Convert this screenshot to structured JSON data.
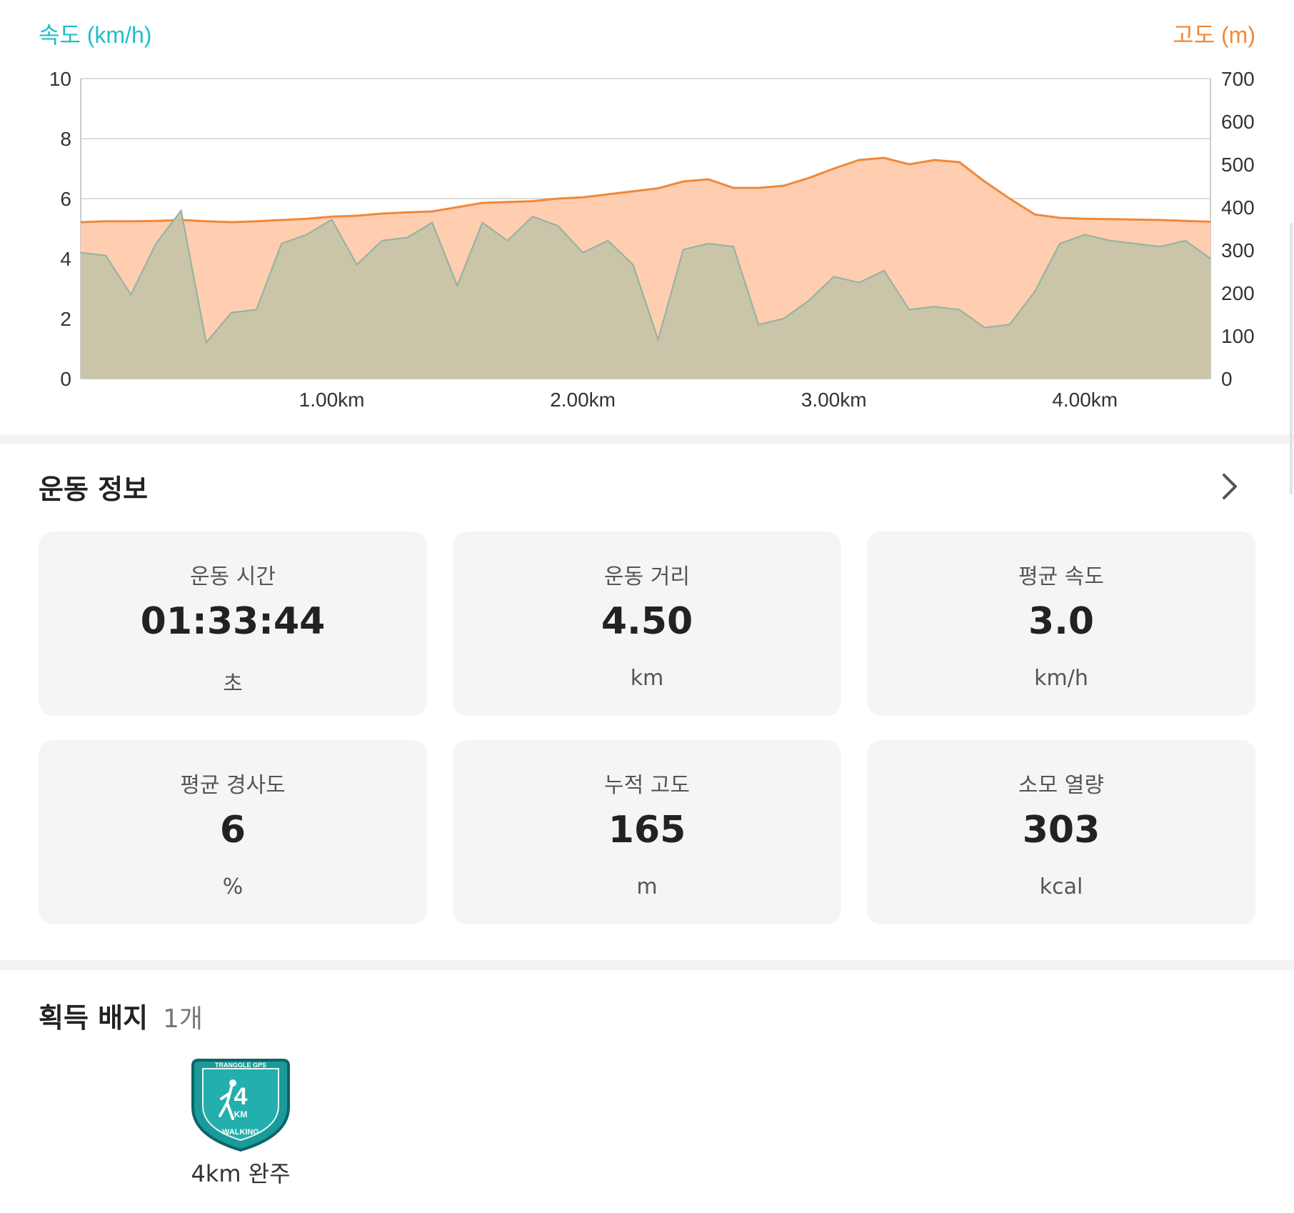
{
  "chart_data": {
    "type": "area",
    "x": [
      0,
      0.1,
      0.2,
      0.3,
      0.4,
      0.5,
      0.6,
      0.7,
      0.8,
      0.9,
      1.0,
      1.1,
      1.2,
      1.3,
      1.4,
      1.5,
      1.6,
      1.7,
      1.8,
      1.9,
      2.0,
      2.1,
      2.2,
      2.3,
      2.4,
      2.5,
      2.6,
      2.7,
      2.8,
      2.9,
      3.0,
      3.1,
      3.2,
      3.3,
      3.4,
      3.5,
      3.6,
      3.7,
      3.8,
      3.9,
      4.0,
      4.1,
      4.2,
      4.3,
      4.4,
      4.5
    ],
    "xlabel": "",
    "x_ticks": [
      "1.00km",
      "2.00km",
      "3.00km",
      "4.00km"
    ],
    "x_tick_values": [
      1,
      2,
      3,
      4
    ],
    "xlim": [
      0,
      4.5
    ],
    "series": [
      {
        "name": "속도 (km/h)",
        "axis": "left",
        "color": "#1fbfc8",
        "values": [
          4.2,
          4.1,
          2.8,
          4.5,
          5.6,
          1.2,
          2.2,
          2.3,
          4.5,
          4.8,
          5.3,
          3.8,
          4.6,
          4.7,
          5.2,
          3.1,
          5.2,
          4.6,
          5.4,
          5.1,
          4.2,
          4.6,
          3.8,
          1.3,
          4.3,
          4.5,
          4.4,
          1.8,
          2.0,
          2.6,
          3.4,
          3.2,
          3.6,
          2.3,
          2.4,
          2.3,
          1.7,
          1.8,
          2.9,
          4.5,
          4.8,
          4.6,
          4.5,
          4.4,
          4.6,
          4.0
        ]
      },
      {
        "name": "고도 (m)",
        "axis": "right",
        "color": "#f0883a",
        "values": [
          365,
          367,
          367,
          368,
          370,
          367,
          365,
          367,
          370,
          373,
          378,
          380,
          385,
          388,
          390,
          400,
          410,
          412,
          414,
          420,
          423,
          430,
          437,
          444,
          460,
          465,
          445,
          445,
          450,
          468,
          490,
          510,
          515,
          500,
          510,
          505,
          460,
          420,
          383,
          375,
          373,
          372,
          371,
          370,
          368,
          366
        ]
      }
    ],
    "ylim": [
      0,
      10
    ],
    "y_ticks": [
      0,
      2,
      4,
      6,
      8,
      10
    ],
    "y2lim": [
      0,
      700
    ],
    "y2_ticks": [
      0,
      100,
      200,
      300,
      400,
      500,
      600,
      700
    ],
    "ylabel": "속도 (km/h)",
    "y2label": "고도 (m)",
    "grid": true,
    "legend": "none"
  },
  "colors": {
    "speed": "#1fbfc8",
    "altitude": "#f0883a",
    "altitude_fill": "#ffcdb0",
    "overlap_fill": "#c6c3a8",
    "grid": "#dddddd"
  },
  "workout": {
    "title": "운동 정보",
    "chevron_icon": "chevron-right-icon",
    "stats": [
      {
        "label": "운동 시간",
        "value": "01:33:44",
        "unit": "초"
      },
      {
        "label": "운동 거리",
        "value": "4.50",
        "unit": "km"
      },
      {
        "label": "평균 속도",
        "value": "3.0",
        "unit": "km/h"
      },
      {
        "label": "평균 경사도",
        "value": "6",
        "unit": "%"
      },
      {
        "label": "누적 고도",
        "value": "165",
        "unit": "m"
      },
      {
        "label": "소모 열량",
        "value": "303",
        "unit": "kcal"
      }
    ]
  },
  "badges": {
    "title": "획득 배지",
    "count": "1개",
    "items": [
      {
        "label": "4km 완주",
        "icon": "walking-badge-icon",
        "emblem_top": "TRANGGLE GPS",
        "emblem_number": "4",
        "emblem_unit": "KM",
        "emblem_bottom": "WALKING",
        "emblem_color": "#1a9a9a"
      }
    ]
  }
}
